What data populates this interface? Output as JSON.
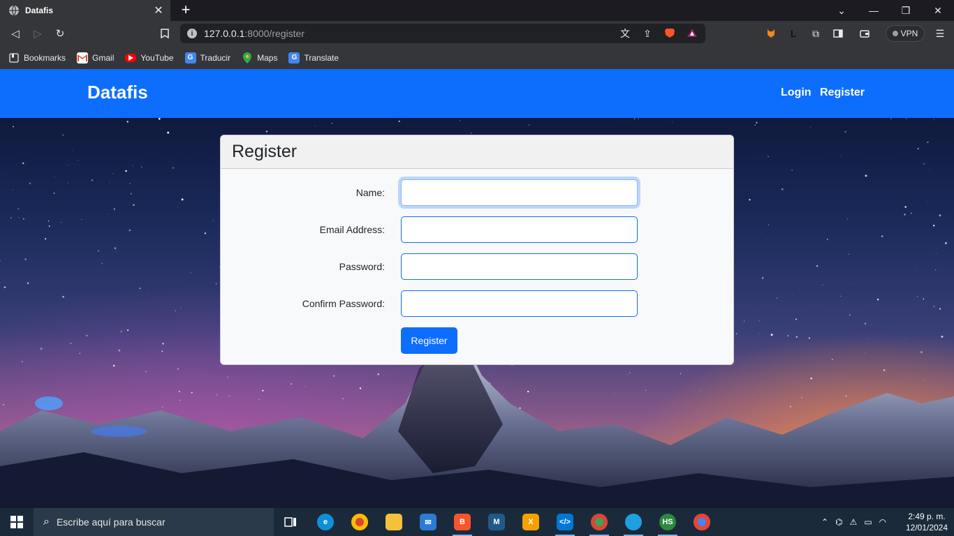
{
  "browser": {
    "tab_title": "Datafis",
    "url_host": "127.0.0.1",
    "url_path": ":8000/register",
    "vpn_label": "VPN"
  },
  "bookmarks": [
    {
      "label": "Bookmarks",
      "icon": "bookmarks-icon"
    },
    {
      "label": "Gmail",
      "icon": "gmail-icon"
    },
    {
      "label": "YouTube",
      "icon": "youtube-icon"
    },
    {
      "label": "Traducir",
      "icon": "translate-icon"
    },
    {
      "label": "Maps",
      "icon": "maps-icon"
    },
    {
      "label": "Translate",
      "icon": "translate-icon"
    }
  ],
  "navbar": {
    "brand": "Datafis",
    "links": [
      "Login",
      "Register"
    ]
  },
  "form": {
    "title": "Register",
    "fields": [
      {
        "label": "Name:",
        "value": ""
      },
      {
        "label": "Email Address:",
        "value": ""
      },
      {
        "label": "Password:",
        "value": ""
      },
      {
        "label": "Confirm Password:",
        "value": ""
      }
    ],
    "submit_label": "Register"
  },
  "taskbar": {
    "search_placeholder": "Escribe aquí para buscar",
    "time": "2:49 p. m.",
    "date": "12/01/2024"
  },
  "colors": {
    "primary": "#0d6efd",
    "chrome_bg": "#35363a",
    "tabbar_bg": "#1c1b22"
  }
}
